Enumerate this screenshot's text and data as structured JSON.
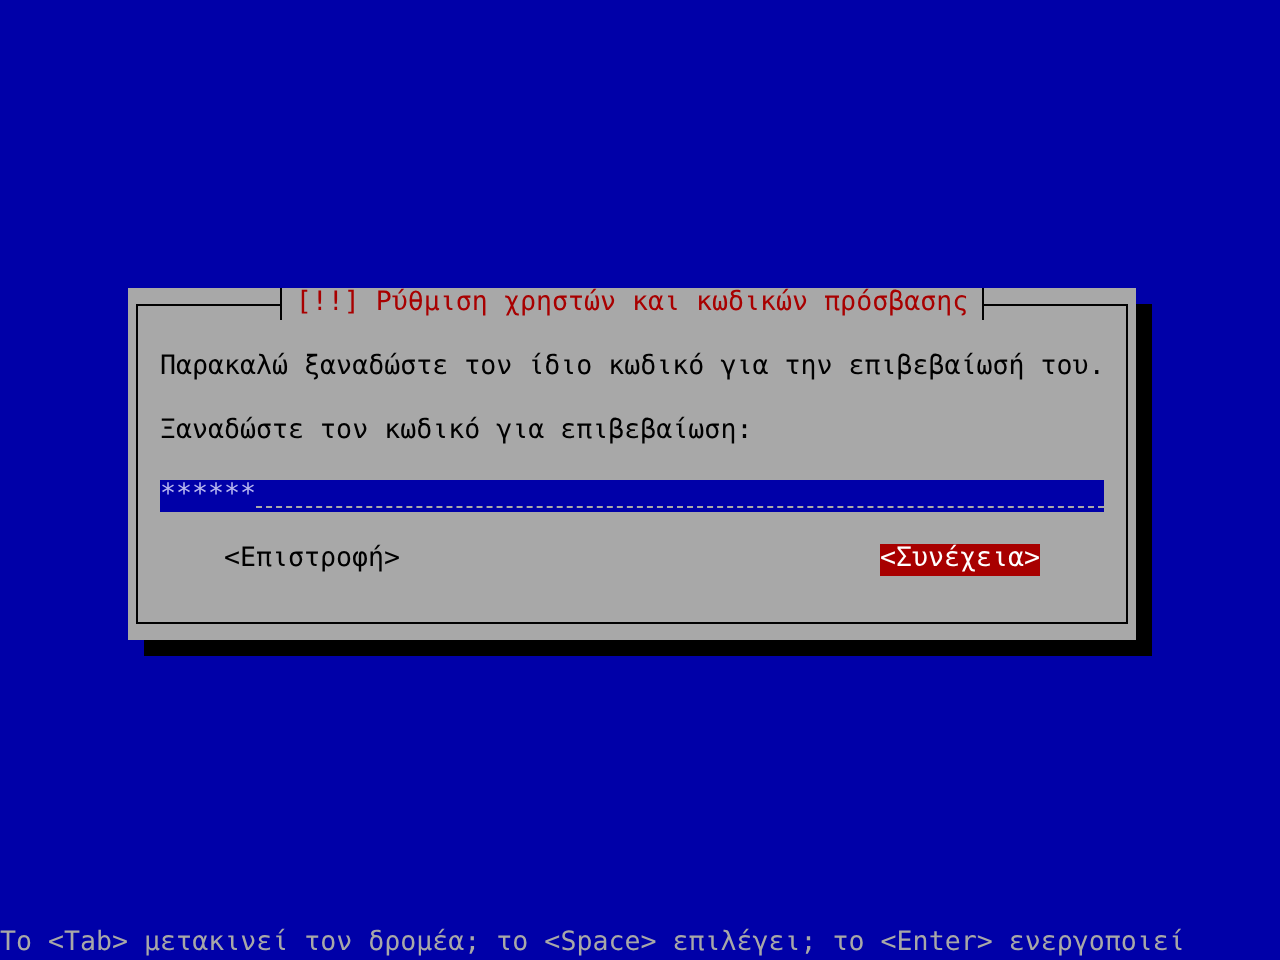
{
  "dialog": {
    "title": "[!!] Ρύθμιση χρηστών και κωδικών πρόσβασης",
    "message": "Παρακαλώ ξαναδώστε τον ίδιο κωδικό για την επιβεβαίωσή του.",
    "prompt": "Ξαναδώστε τον κωδικό για επιβεβαίωση:",
    "field": {
      "value": "******"
    },
    "buttons": [
      {
        "label": "<Επιστροφή>",
        "selected": false
      },
      {
        "label": "<Συνέχεια>",
        "selected": true
      }
    ]
  },
  "status_bar": "Το <Tab> μετακινεί τον δρομέα; το <Space> επιλέγει; το <Enter> ενεργοποιεί"
}
